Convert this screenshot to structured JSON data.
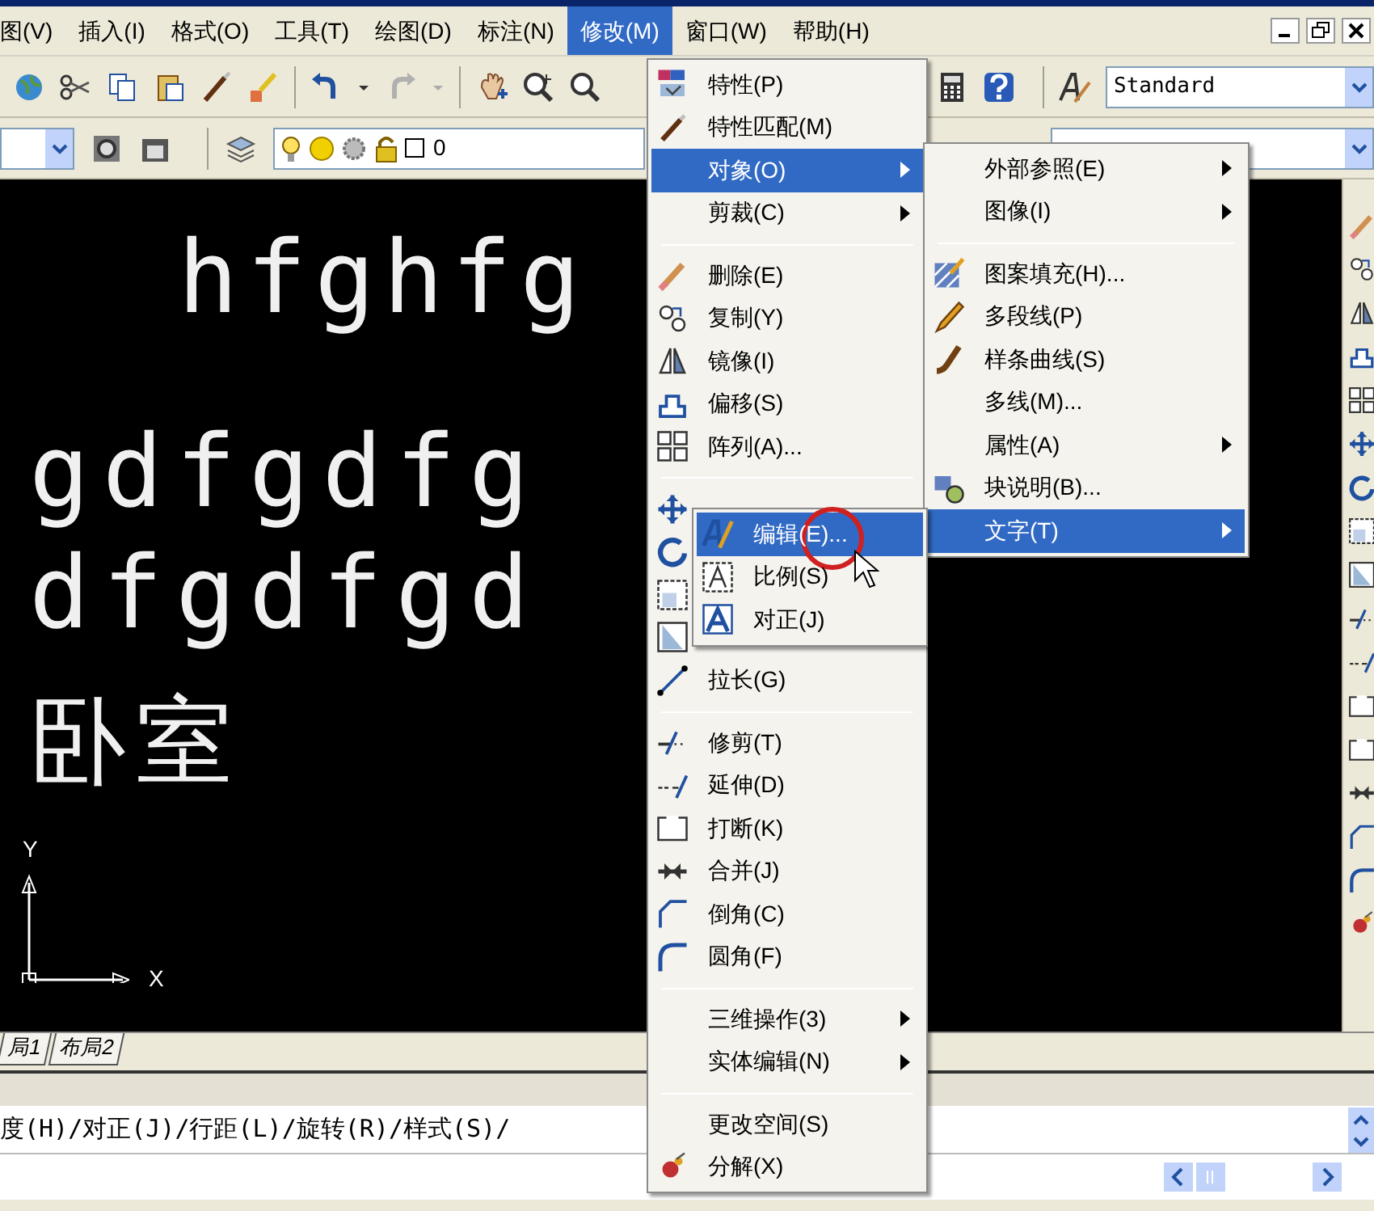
{
  "menu_bar": [
    {
      "label": "图(V)",
      "selected": false
    },
    {
      "label": "插入(I)",
      "selected": false
    },
    {
      "label": "格式(O)",
      "selected": false
    },
    {
      "label": "工具(T)",
      "selected": false
    },
    {
      "label": "绘图(D)",
      "selected": false
    },
    {
      "label": "标注(N)",
      "selected": false
    },
    {
      "label": "修改(M)",
      "selected": true
    },
    {
      "label": "窗口(W)",
      "selected": false
    },
    {
      "label": "帮助(H)",
      "selected": false
    }
  ],
  "toolbar": {
    "text_style": "Standard",
    "layer": "0"
  },
  "canvas": {
    "texts": [
      "hfghfg",
      "gdfgdfg",
      "dfgdfgd",
      "卧室"
    ],
    "axis_y": "Y",
    "axis_x": "X"
  },
  "layout_tabs": [
    {
      "label": "局1"
    },
    {
      "label": "布局2"
    }
  ],
  "command_line": {
    "text": "度(H)/对正(J)/行距(L)/旋转(R)/样式(S)/"
  },
  "modify_menu": [
    {
      "kind": "item",
      "label": "特性(P)",
      "selected": false
    },
    {
      "kind": "item",
      "label": "特性匹配(M)",
      "selected": false
    },
    {
      "kind": "submenu",
      "label": "对象(O)",
      "selected": true
    },
    {
      "kind": "submenu",
      "label": "剪裁(C)",
      "selected": false
    },
    {
      "kind": "separator"
    },
    {
      "kind": "item",
      "label": "删除(E)",
      "selected": false
    },
    {
      "kind": "item",
      "label": "复制(Y)",
      "selected": false
    },
    {
      "kind": "item",
      "label": "镜像(I)",
      "selected": false
    },
    {
      "kind": "item",
      "label": "偏移(S)",
      "selected": false
    },
    {
      "kind": "item",
      "label": "阵列(A)...",
      "selected": false
    },
    {
      "kind": "separator"
    },
    {
      "kind": "covered"
    },
    {
      "kind": "covered"
    },
    {
      "kind": "covered"
    },
    {
      "kind": "covered"
    },
    {
      "kind": "item",
      "label": "拉长(G)",
      "selected": false
    },
    {
      "kind": "separator"
    },
    {
      "kind": "item",
      "label": "修剪(T)",
      "selected": false
    },
    {
      "kind": "item",
      "label": "延伸(D)",
      "selected": false
    },
    {
      "kind": "item",
      "label": "打断(K)",
      "selected": false
    },
    {
      "kind": "item",
      "label": "合并(J)",
      "selected": false
    },
    {
      "kind": "item",
      "label": "倒角(C)",
      "selected": false
    },
    {
      "kind": "item",
      "label": "圆角(F)",
      "selected": false
    },
    {
      "kind": "separator"
    },
    {
      "kind": "submenu",
      "label": "三维操作(3)",
      "selected": false
    },
    {
      "kind": "submenu",
      "label": "实体编辑(N)",
      "selected": false
    },
    {
      "kind": "separator"
    },
    {
      "kind": "item",
      "label": "更改空间(S)",
      "selected": false
    },
    {
      "kind": "item",
      "label": "分解(X)",
      "selected": false
    }
  ],
  "object_submenu": [
    {
      "kind": "submenu",
      "label": "外部参照(E)",
      "selected": false
    },
    {
      "kind": "submenu",
      "label": "图像(I)",
      "selected": false
    },
    {
      "kind": "separator"
    },
    {
      "kind": "item",
      "label": "图案填充(H)...",
      "selected": false
    },
    {
      "kind": "item",
      "label": "多段线(P)",
      "selected": false
    },
    {
      "kind": "item",
      "label": "样条曲线(S)",
      "selected": false
    },
    {
      "kind": "item",
      "label": "多线(M)...",
      "selected": false
    },
    {
      "kind": "submenu",
      "label": "属性(A)",
      "selected": false
    },
    {
      "kind": "item",
      "label": "块说明(B)...",
      "selected": false
    },
    {
      "kind": "submenu",
      "label": "文字(T)",
      "selected": true
    }
  ],
  "text_submenu": [
    {
      "kind": "item",
      "label": "编辑(E)...",
      "selected": true
    },
    {
      "kind": "item",
      "label": "比例(S)",
      "selected": false
    },
    {
      "kind": "item",
      "label": "对正(J)",
      "selected": false
    }
  ]
}
